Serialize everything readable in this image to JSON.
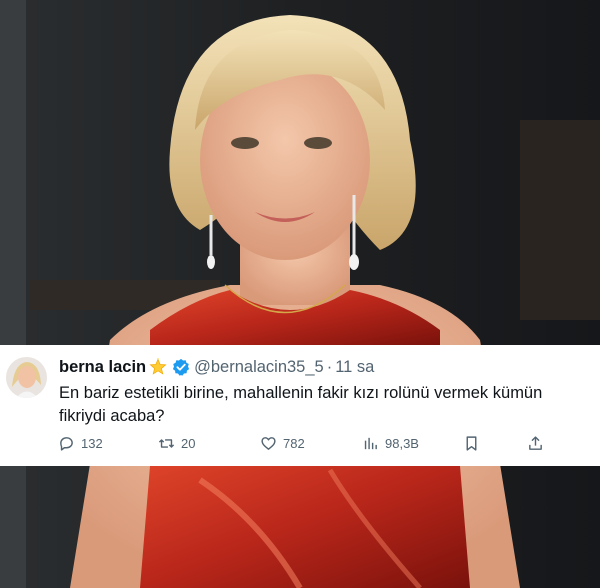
{
  "tweet": {
    "display_name": "berna lacin",
    "handle": "@bernalacin35_5",
    "separator": "·",
    "time": "11 sa",
    "text": "En bariz estetikli birine, mahallenin fakir kızı rolünü vermek kümün fikriydi acaba?",
    "name_emoji_icon": "glowing-star-icon",
    "verified_icon": "verified-badge-icon",
    "accent_color": "#1d9bf0"
  },
  "actions": {
    "replies": "132",
    "retweets": "20",
    "likes": "782",
    "views": "98,3B"
  }
}
